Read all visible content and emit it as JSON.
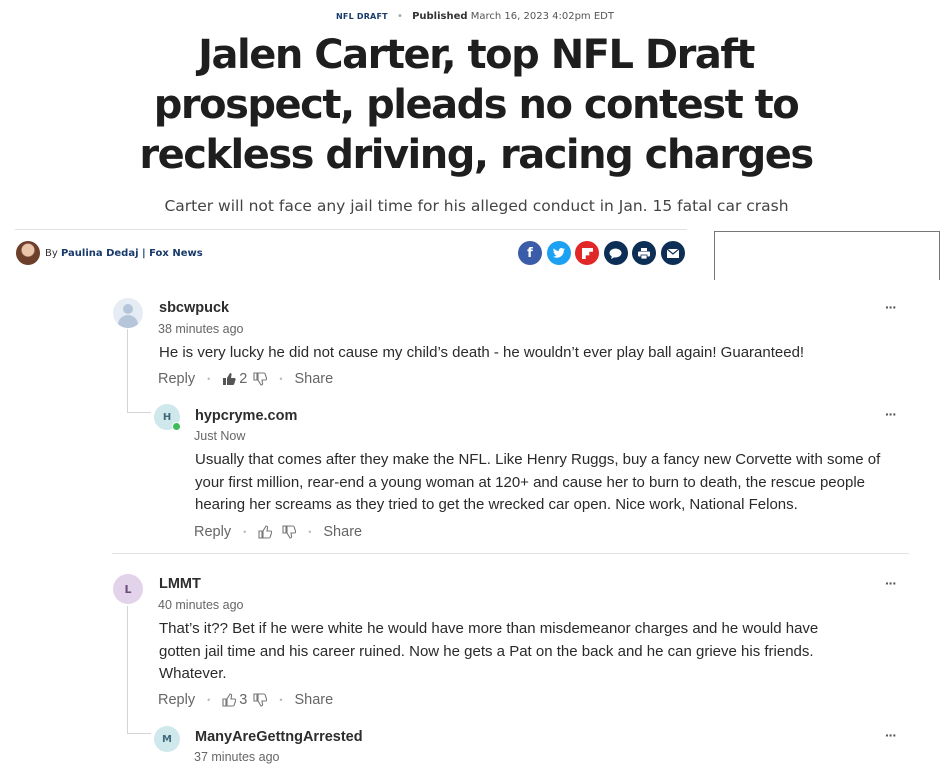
{
  "article": {
    "category": "NFL DRAFT",
    "published_label": "Published",
    "published_date": "March 16, 2023 4:02pm EDT",
    "headline": "Jalen Carter, top NFL Draft prospect, pleads no contest to reckless driving, racing charges",
    "subhead": "Carter will not face any jail time for his alleged conduct in Jan. 15 fatal car crash",
    "byline_prefix": "By",
    "author": "Paulina Dedaj | Fox News",
    "share_icons": [
      "facebook-icon",
      "twitter-icon",
      "flipboard-icon",
      "comment-icon",
      "print-icon",
      "email-icon"
    ]
  },
  "comments": [
    {
      "username": "sbcwpuck",
      "time": "38 minutes ago",
      "body": "He is very lucky he did not cause my child’s death - he wouldn’t ever play ball again!  Guaranteed!",
      "reply": "Reply",
      "likes": "2",
      "share": "Share",
      "menu": "···"
    },
    {
      "avatar_letter": "H",
      "username": "hypcryme.com",
      "time": "Just Now",
      "body": "Usually that comes after they make the NFL.  Like Henry Ruggs, buy a fancy new Corvette with some of your first million, rear-end a young woman at 120+ and cause her to burn to death, the rescue people hearing her screams as they tried to get the wrecked car open.   Nice work, National Felons.",
      "reply": "Reply",
      "share": "Share",
      "menu": "···"
    },
    {
      "avatar_letter": "L",
      "username": "LMMT",
      "time": "40 minutes ago",
      "body": "That’s it?? Bet if he were white he would have more than misdemeanor charges and he would have gotten jail time and his career ruined. Now he gets a Pat on the back and he can grieve his friends. Whatever.",
      "reply": "Reply",
      "likes": "3",
      "share": "Share",
      "menu": "···"
    },
    {
      "avatar_letter": "M",
      "username": "ManyAreGettngArrested",
      "time": "37 minutes ago",
      "menu": "···"
    }
  ],
  "colors": {
    "brand_navy": "#183a6b",
    "online": "#3bbd5a"
  }
}
